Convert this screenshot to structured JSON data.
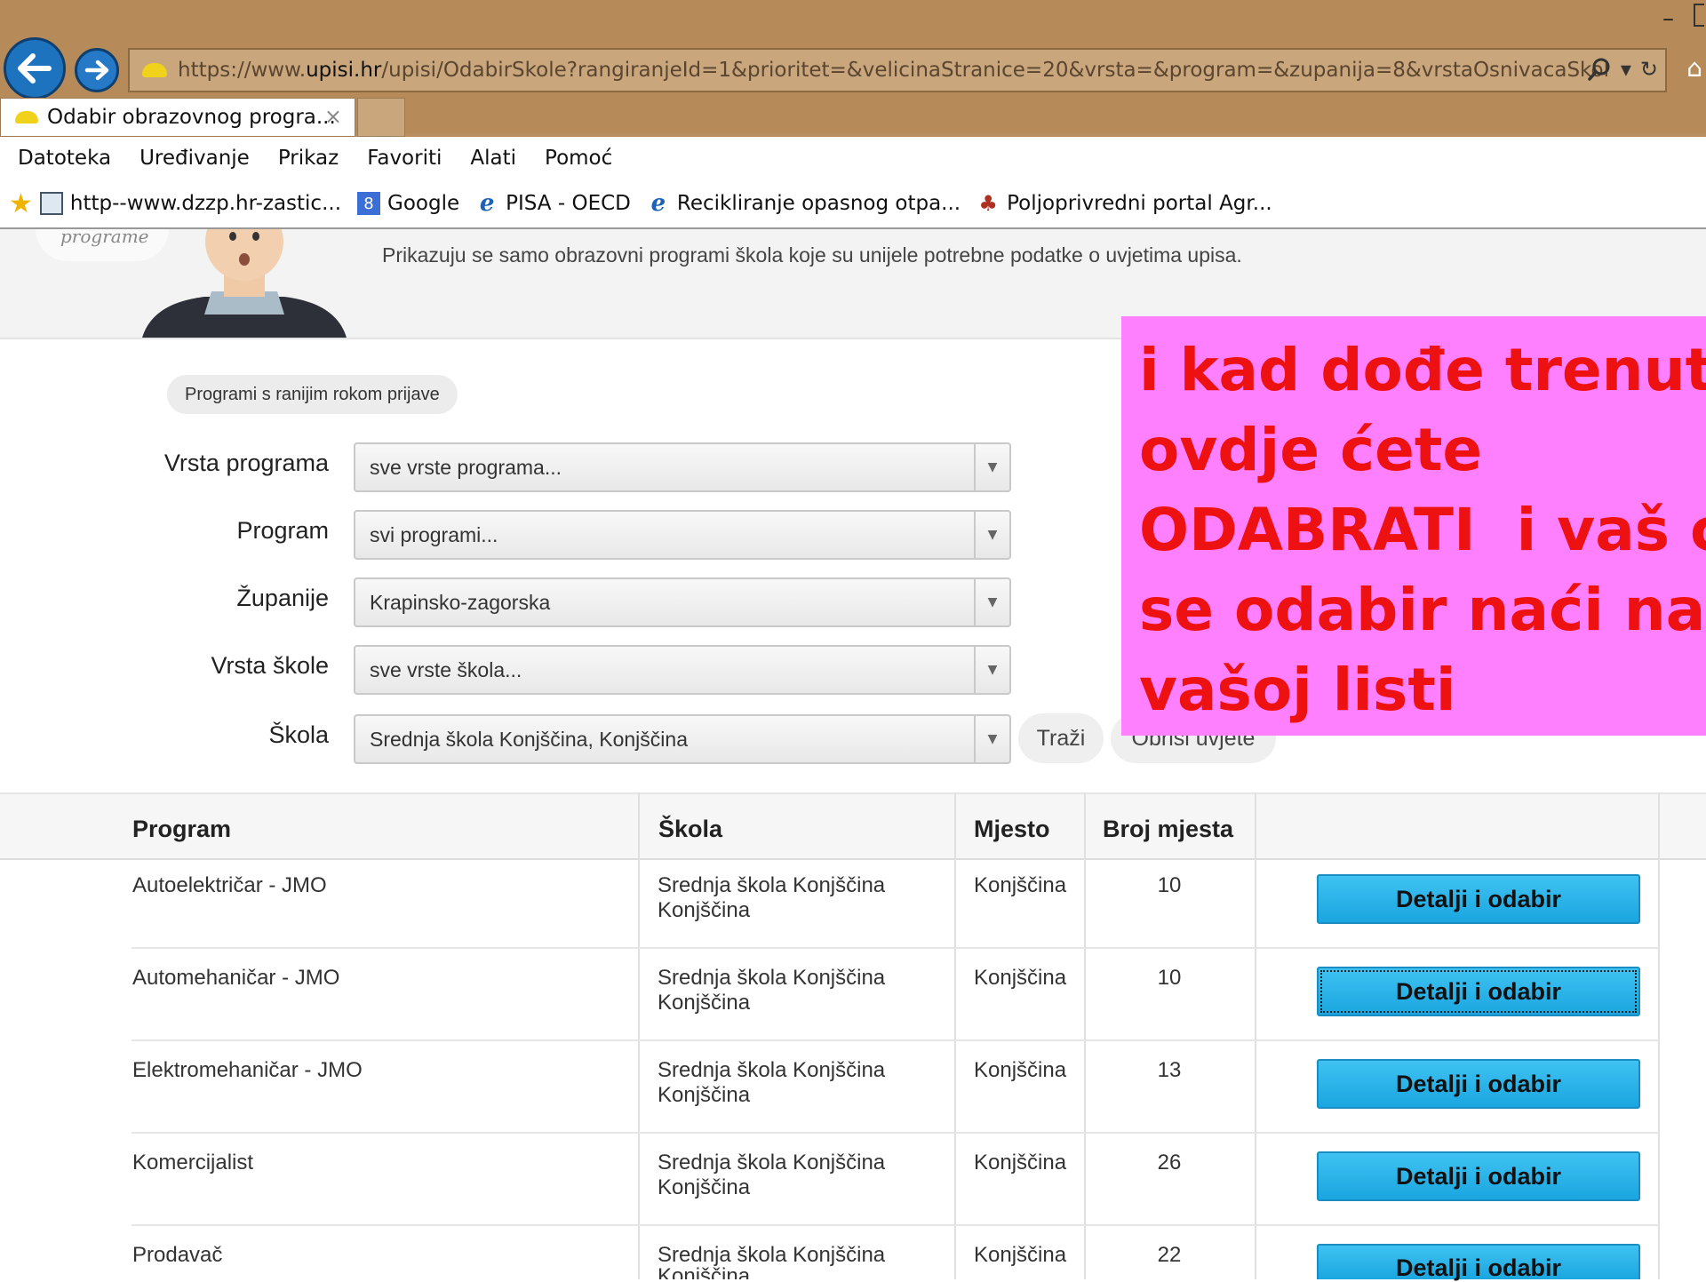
{
  "browser": {
    "url_prefix": "https://www.",
    "url_domain": "upisi.hr",
    "url_rest": "/upisi/OdabirSkole?rangiranjeId=1&prioritet=&velicinaStranice=20&vrsta=&program=&zupanija=8&vrstaOsnivacaSkole=&skol",
    "tab_title": "Odabir obrazovnog progra...",
    "tab_close": "×",
    "minimize": "–",
    "menu": [
      "Datoteka",
      "Uređivanje",
      "Prikaz",
      "Favoriti",
      "Alati",
      "Pomoć"
    ],
    "favorites": [
      {
        "label": "http--www.dzzp.hr-zastic...",
        "icon": "image-icon"
      },
      {
        "label": "Google",
        "icon": "google-icon"
      },
      {
        "label": "PISA - OECD",
        "icon": "ie-icon"
      },
      {
        "label": "Recikliranje opasnog otpa...",
        "icon": "ie-icon"
      },
      {
        "label": "Poljoprivredni portal  Agr...",
        "icon": "plant-icon"
      }
    ]
  },
  "hero": {
    "logo_text": "programe",
    "notice": "Prikazuju se samo obrazovni programi škola koje su unijele potrebne podatke o uvjetima upisa."
  },
  "filters": {
    "early_button": "Programi s ranijim rokom prijave",
    "fields": [
      {
        "label": "Vrsta programa",
        "value": "sve vrste programa..."
      },
      {
        "label": "Program",
        "value": "svi programi..."
      },
      {
        "label": "Županije",
        "value": "Krapinsko-zagorska"
      },
      {
        "label": "Vrsta škole",
        "value": "sve vrste škola..."
      },
      {
        "label": "Škola",
        "value": "Srednja škola Konjščina, Konjščina"
      }
    ],
    "search_button": "Traži",
    "clear_button": "Obriši uvjete"
  },
  "table": {
    "headers": [
      "Program",
      "Škola",
      "Mjesto",
      "Broj mjesta"
    ],
    "rows": [
      {
        "program": "Autoelektričar - JMO",
        "school_line1": "Srednja škola Konjščina",
        "school_line2": "Konjščina",
        "place": "Konjščina",
        "count": "10",
        "button": "Detalji i odabir"
      },
      {
        "program": "Automehaničar - JMO",
        "school_line1": "Srednja škola Konjščina",
        "school_line2": "Konjščina",
        "place": "Konjščina",
        "count": "10",
        "button": "Detalji i odabir"
      },
      {
        "program": "Elektromehaničar - JMO",
        "school_line1": "Srednja škola Konjščina",
        "school_line2": "Konjščina",
        "place": "Konjščina",
        "count": "13",
        "button": "Detalji i odabir"
      },
      {
        "program": "Komercijalist",
        "school_line1": "Srednja škola Konjščina",
        "school_line2": "Konjščina",
        "place": "Konjščina",
        "count": "26",
        "button": "Detalji i odabir"
      },
      {
        "program": "Prodavač",
        "school_line1": "Srednja škola Konjščina",
        "school_line2": "Konjščina",
        "place": "Konjščina",
        "count": "22",
        "button": "Detalji i odabir"
      }
    ]
  },
  "overlay": {
    "text": "i kad dođe trenutak\novdje ćete\nODABRATI  i vaš će\nse odabir naći na\nvašoj listi",
    "background": "#ff80ff",
    "color": "#ee1111"
  },
  "colors": {
    "chrome": "#b68a59",
    "button_blue": "#1aa6e0"
  }
}
